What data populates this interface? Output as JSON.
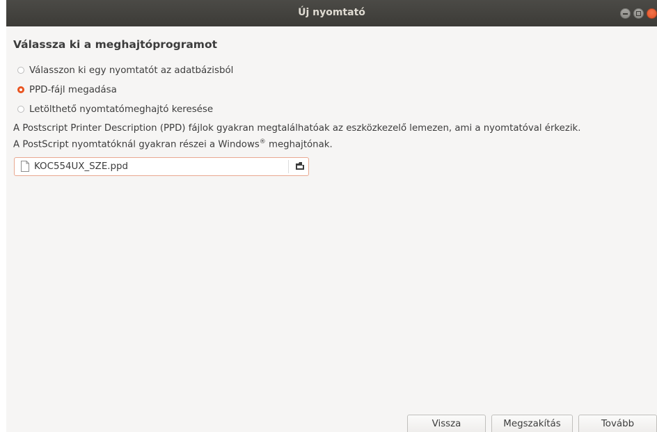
{
  "window": {
    "title": "Új nyomtató"
  },
  "page": {
    "heading": "Válassza ki a meghajtóprogramot"
  },
  "options": [
    {
      "label": "Válasszon ki egy nyomtatót az adatbázisból",
      "selected": false
    },
    {
      "label": "PPD-fájl megadása",
      "selected": true
    },
    {
      "label": "Letölthető nyomtatómeghajtó keresése",
      "selected": false
    }
  ],
  "description": {
    "line1": "A Postscript Printer Description (PPD) fájlok gyakran megtalálhatóak az eszközkezelő lemezen, ami a nyomtatóval érkezik.",
    "line2_prefix": "A PostScript nyomtatóknál gyakran részei a Windows",
    "line2_sup": "®",
    "line2_suffix": " meghajtónak."
  },
  "file_chooser": {
    "file_name": "KOC554UX_SZE.ppd",
    "file_icon": "file-icon",
    "button_icon": "open-folder-icon"
  },
  "buttons": {
    "back": "Vissza",
    "cancel": "Megszakítás",
    "next": "Tovább"
  },
  "colors": {
    "accent": "#e95420",
    "titlebar": "#3c3b37"
  }
}
